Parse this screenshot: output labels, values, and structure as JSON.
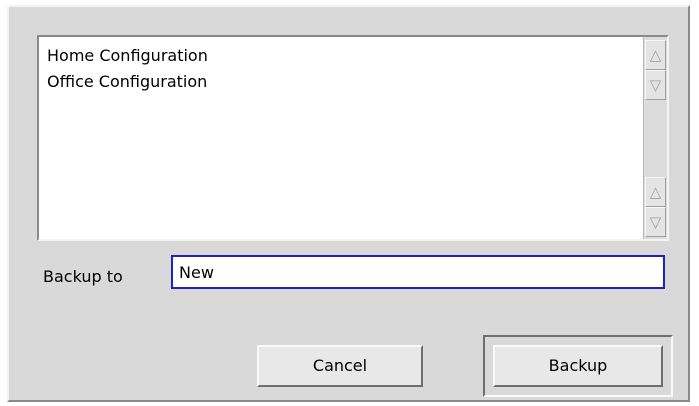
{
  "list": {
    "items": [
      {
        "label": "Home Configuration"
      },
      {
        "label": "Office Configuration"
      }
    ],
    "scroll_up_icon": "triangle-up-icon",
    "scroll_down_icon": "triangle-down-icon"
  },
  "backup_field": {
    "label": "Backup to",
    "value": "New"
  },
  "buttons": {
    "cancel_label": "Cancel",
    "backup_label": "Backup",
    "default": "Backup"
  },
  "colors": {
    "dialog_bg": "#d9d9d9",
    "input_focus_border": "#2222bb"
  }
}
